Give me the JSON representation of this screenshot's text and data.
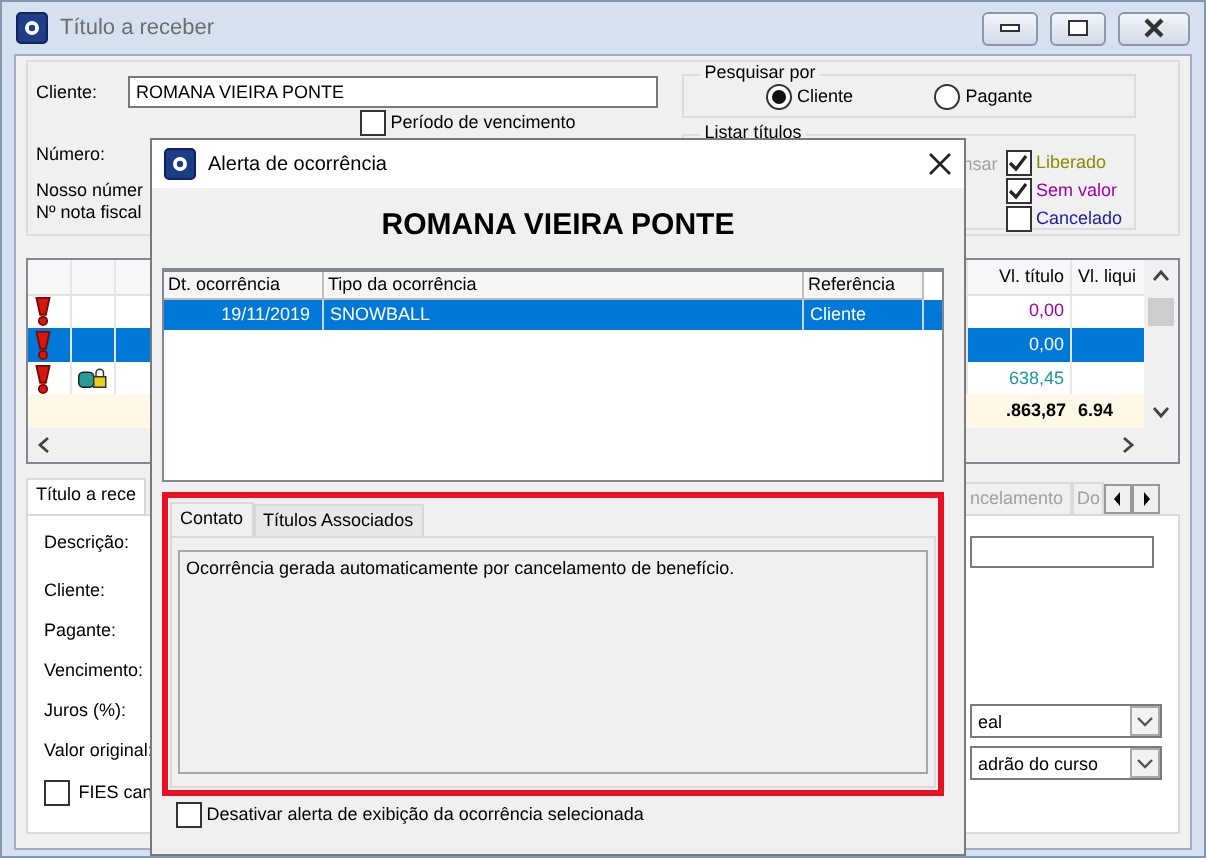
{
  "window": {
    "title": "Título a receber"
  },
  "filters": {
    "cliente_label": "Cliente:",
    "cliente_value": "ROMANA VIEIRA PONTE",
    "periodo": {
      "label": "Período de vencimento",
      "checked": false
    },
    "numero_label": "Número:",
    "nosso_numero_label": "Nosso númer",
    "nota_fiscal_label": "Nº nota fiscal"
  },
  "search_by": {
    "title": "Pesquisar por",
    "options": [
      {
        "label": "Cliente",
        "selected": true
      },
      {
        "label": "Pagante",
        "selected": false
      }
    ]
  },
  "list_titles": {
    "title": "Listar títulos",
    "partial_label": "nsar",
    "options": [
      {
        "label": "Liberado",
        "checked": true,
        "color": "#8b8b00"
      },
      {
        "label": "Sem valor",
        "checked": true,
        "color": "#a000a0"
      },
      {
        "label": "Cancelado",
        "checked": false,
        "color": "#1c1c9c"
      }
    ]
  },
  "grid": {
    "columns": [
      "Vl. título",
      "Vl. liqui"
    ],
    "rows": [
      {
        "icons": [
          {
            "kind": "alert"
          }
        ],
        "selected": false,
        "value": "0,00",
        "color": "#a000a0"
      },
      {
        "icons": [
          {
            "kind": "alert"
          }
        ],
        "selected": true,
        "value": "0,00"
      },
      {
        "icons": [
          {
            "kind": "alert"
          },
          {
            "kind": "lock"
          }
        ],
        "selected": false,
        "value": "638,45",
        "color": "#199999"
      }
    ],
    "totals": [
      ".863,87",
      "6.94"
    ]
  },
  "detail_tabs": [
    {
      "label": "Título a rece",
      "selected": true,
      "disabled": false
    },
    {
      "label": "ncelamento",
      "selected": false,
      "disabled": true
    },
    {
      "label": "Do",
      "selected": false,
      "disabled": true
    }
  ],
  "detail_labels": [
    "Descrição:",
    "Cliente:",
    "Pagante:",
    "Vencimento:",
    "Juros (%):",
    "Valor original:"
  ],
  "fies": {
    "label": "FIES can",
    "checked": false
  },
  "detail_selects": [
    "eal",
    "adrão do curso"
  ],
  "dialog": {
    "title": "Alerta de ocorrência",
    "client_name": "ROMANA VIEIRA PONTE",
    "table": {
      "columns": [
        "Dt. ocorrência",
        "Tipo da ocorrência",
        "Referência"
      ],
      "rows": [
        {
          "cells": [
            "19/11/2019",
            "SNOWBALL",
            "Cliente"
          ],
          "selected": true
        }
      ]
    },
    "tabs": [
      {
        "label": "Contato",
        "selected": true
      },
      {
        "label": "Títulos Associados",
        "selected": false
      }
    ],
    "message": "Ocorrência gerada automaticamente por cancelamento de benefício.",
    "disable_alert": {
      "label": "Desativar alerta de exibição da ocorrência selecionada",
      "checked": false
    }
  }
}
